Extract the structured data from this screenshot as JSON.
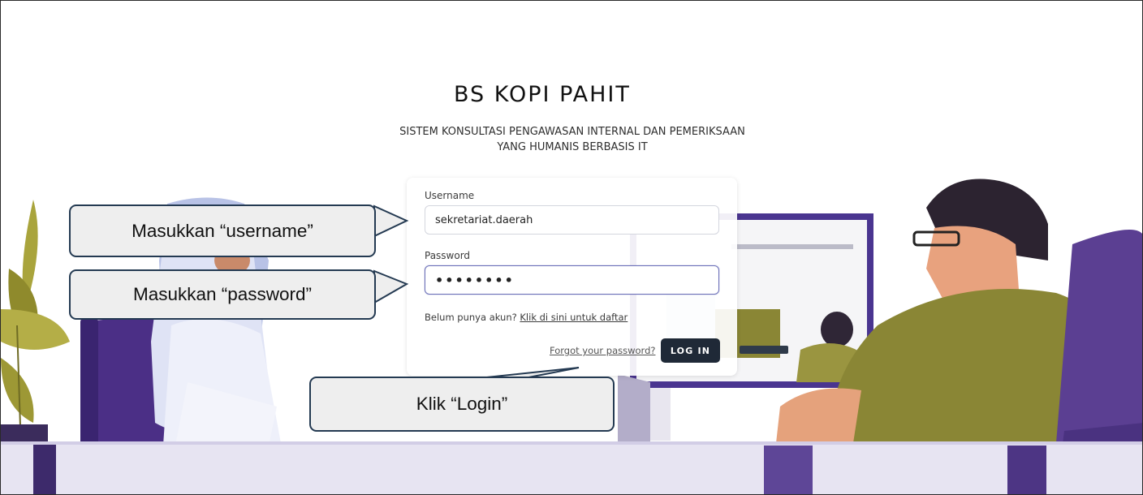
{
  "brand": {
    "logo_text": "BS KOPI PAHIT"
  },
  "tagline": {
    "line1": "SISTEM KONSULTASI PENGAWASAN INTERNAL DAN PEMERIKSAAN",
    "line2": "YANG HUMANIS BERBASIS IT"
  },
  "form": {
    "username_label": "Username",
    "username_value": "sekretariat.daerah",
    "password_label": "Password",
    "password_value": "••••••••",
    "register_prompt": "Belum punya akun?",
    "register_link": "Klik di sini untuk daftar",
    "forgot_link": "Forgot your password?",
    "login_button": "LOG IN"
  },
  "callouts": {
    "username": "Masukkan “username”",
    "password": "Masukkan “password”",
    "login": "Klik “Login”"
  },
  "colors": {
    "login_button_bg": "#1f2937",
    "callout_bg": "#eeeeee",
    "callout_border": "#243a52",
    "illustration_purple": "#5a3f8f",
    "illustration_olive": "#8a8635"
  }
}
